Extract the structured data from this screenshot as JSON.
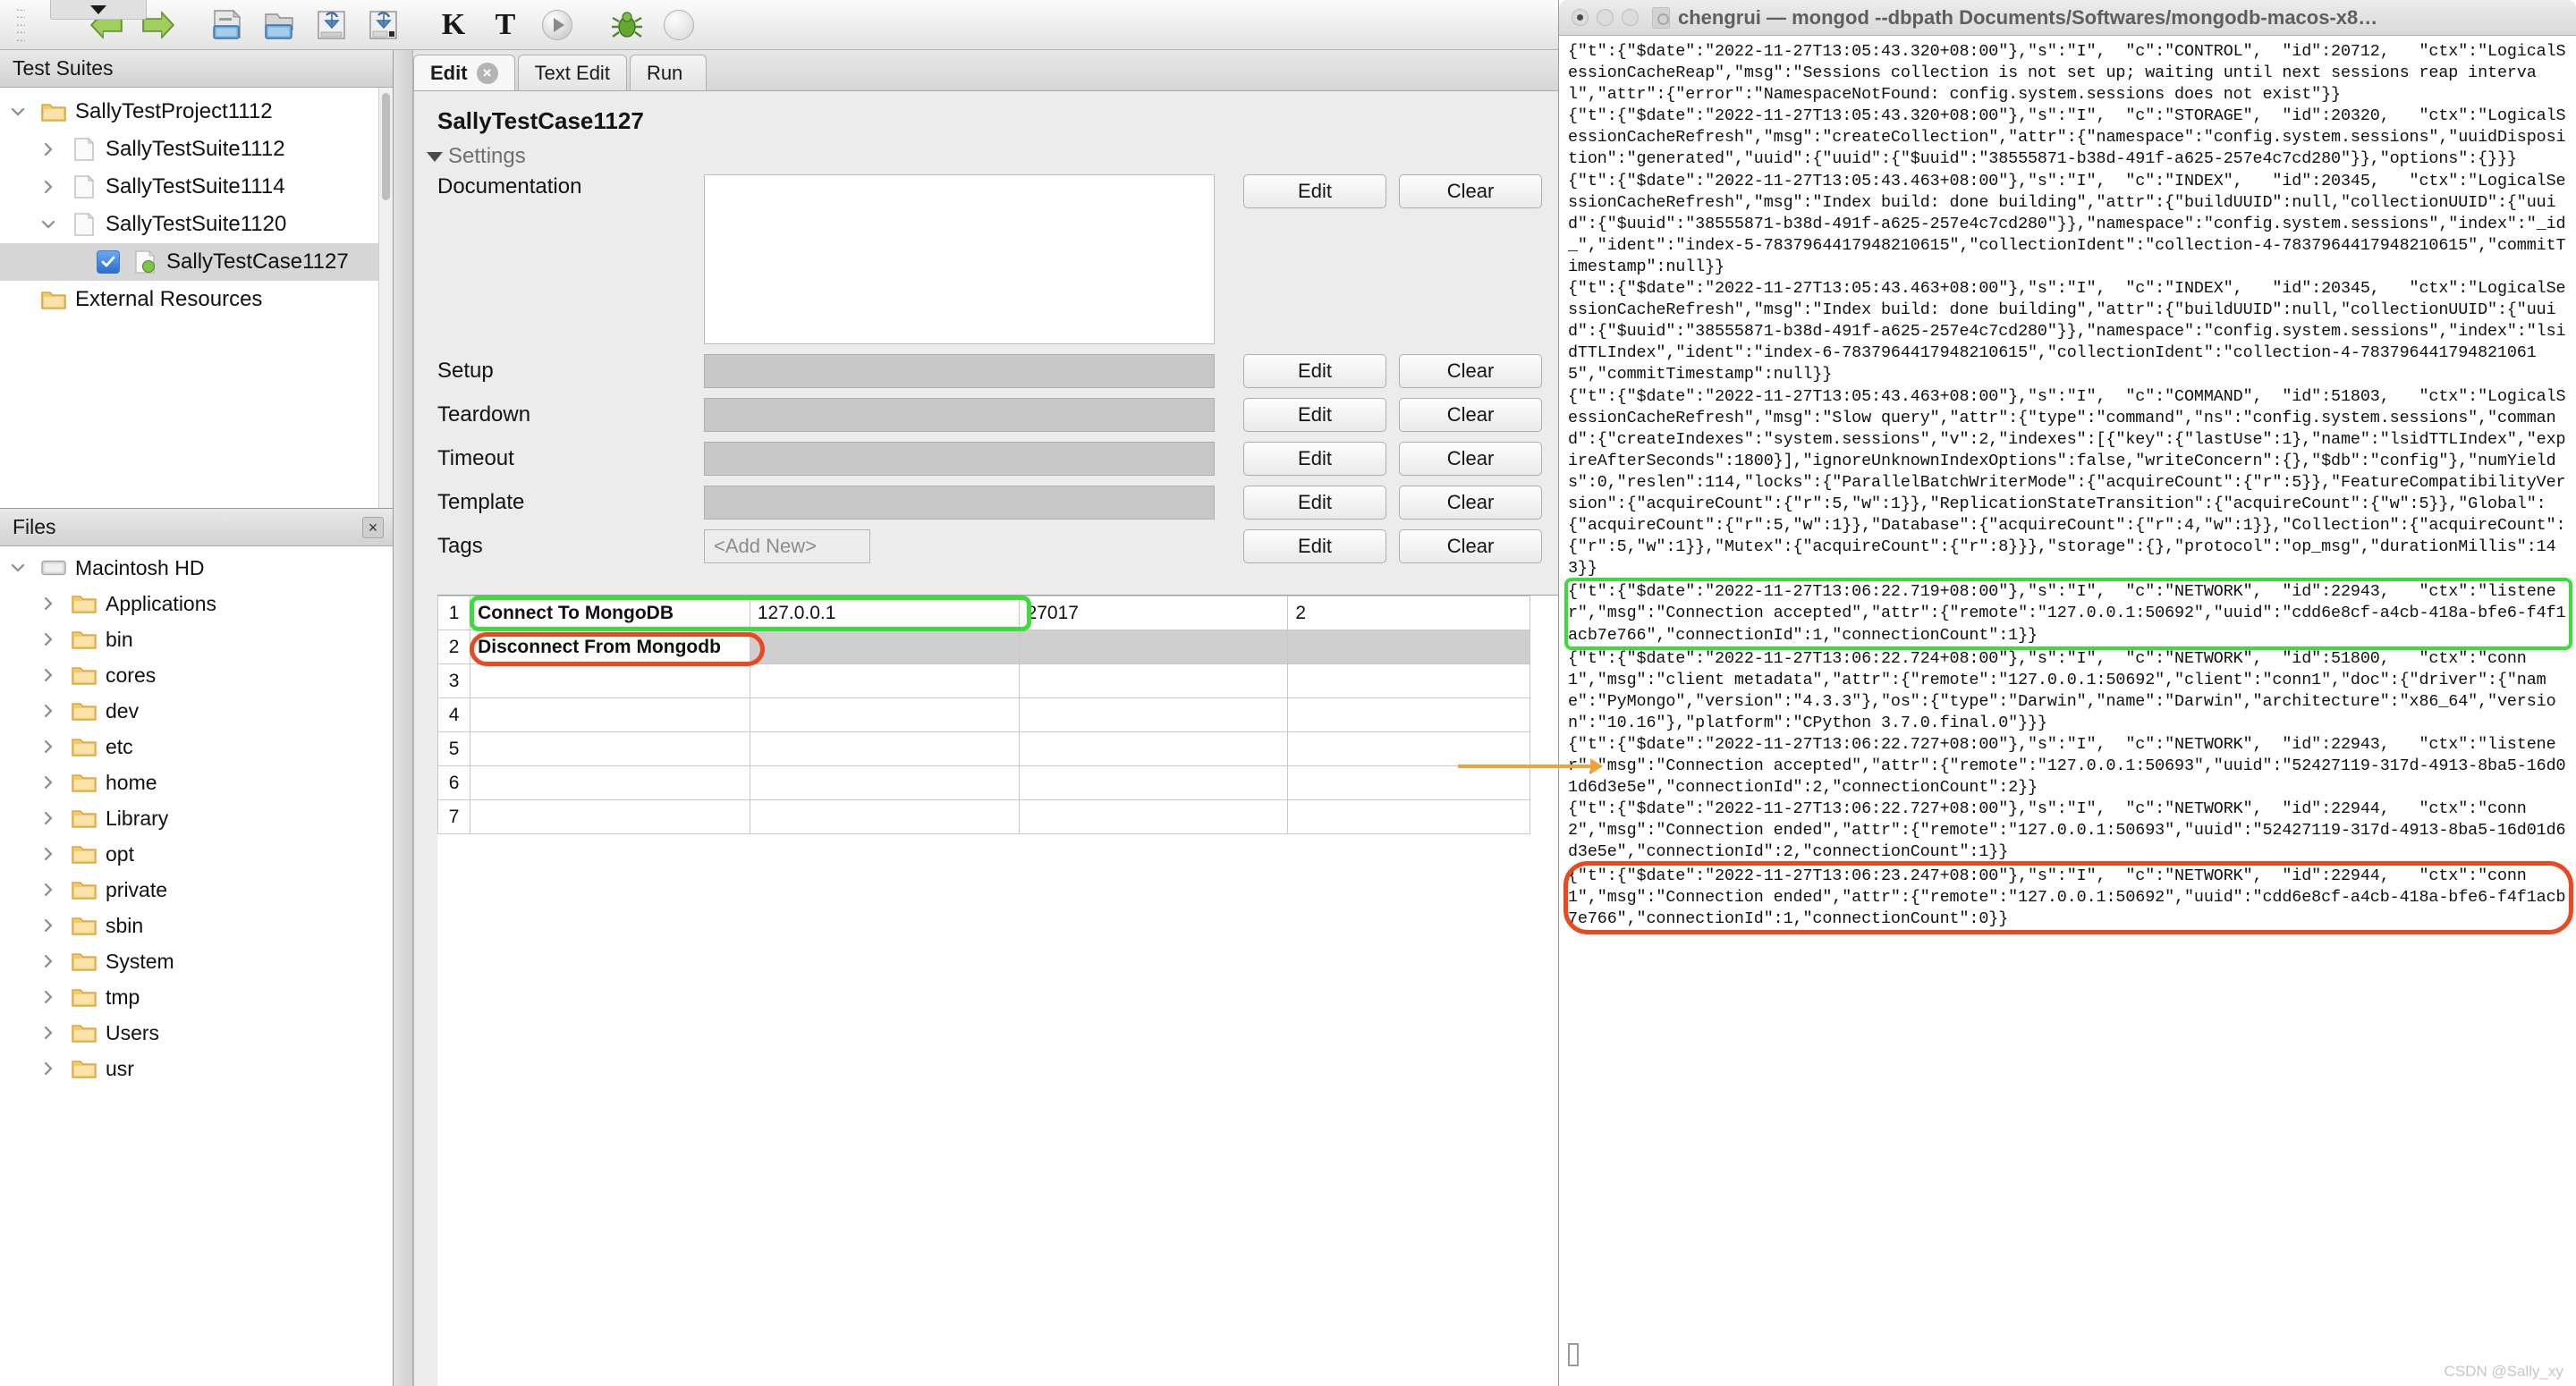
{
  "toolbar": {
    "icons": [
      {
        "name": "back-arrow-icon",
        "label": "Back"
      },
      {
        "name": "forward-arrow-icon",
        "label": "Forward"
      },
      {
        "name": "new-file-icon",
        "label": "New"
      },
      {
        "name": "open-folder-icon",
        "label": "Open"
      },
      {
        "name": "save-icon",
        "label": "Save"
      },
      {
        "name": "save-all-icon",
        "label": "Save All"
      },
      {
        "name": "keyword-k-icon",
        "label": "K"
      },
      {
        "name": "testcase-t-icon",
        "label": "T"
      },
      {
        "name": "run-circle-icon",
        "label": "Run"
      },
      {
        "name": "bug-icon",
        "label": "Debug"
      },
      {
        "name": "stop-circle-icon",
        "label": "Stop"
      }
    ]
  },
  "test_suites_pane": {
    "title": "Test Suites",
    "tree": [
      {
        "label": "SallyTestProject1112",
        "depth": 0,
        "twist": "down",
        "icon": "folder-icon",
        "selected": false,
        "checkbox": false
      },
      {
        "label": "SallyTestSuite1112",
        "depth": 1,
        "twist": "right",
        "icon": "file-icon",
        "selected": false,
        "checkbox": false
      },
      {
        "label": "SallyTestSuite1114",
        "depth": 1,
        "twist": "right",
        "icon": "file-icon",
        "selected": false,
        "checkbox": false
      },
      {
        "label": "SallyTestSuite1120",
        "depth": 1,
        "twist": "down",
        "icon": "file-icon",
        "selected": false,
        "checkbox": false
      },
      {
        "label": "SallyTestCase1127",
        "depth": 2,
        "twist": "none",
        "icon": "testcase-icon",
        "selected": true,
        "checkbox": true
      },
      {
        "label": "External Resources",
        "depth": 0,
        "twist": "none",
        "icon": "folder-icon",
        "selected": false,
        "checkbox": false
      }
    ]
  },
  "files_pane": {
    "title": "Files",
    "tree": [
      {
        "label": "Macintosh HD",
        "depth": 0,
        "twist": "down",
        "icon": "drive-icon"
      },
      {
        "label": "Applications",
        "depth": 1,
        "twist": "right",
        "icon": "folder-icon"
      },
      {
        "label": "bin",
        "depth": 1,
        "twist": "right",
        "icon": "folder-icon"
      },
      {
        "label": "cores",
        "depth": 1,
        "twist": "right",
        "icon": "folder-icon"
      },
      {
        "label": "dev",
        "depth": 1,
        "twist": "right",
        "icon": "folder-icon"
      },
      {
        "label": "etc",
        "depth": 1,
        "twist": "right",
        "icon": "folder-icon"
      },
      {
        "label": "home",
        "depth": 1,
        "twist": "right",
        "icon": "folder-icon"
      },
      {
        "label": "Library",
        "depth": 1,
        "twist": "right",
        "icon": "folder-icon"
      },
      {
        "label": "opt",
        "depth": 1,
        "twist": "right",
        "icon": "folder-icon"
      },
      {
        "label": "private",
        "depth": 1,
        "twist": "right",
        "icon": "folder-icon"
      },
      {
        "label": "sbin",
        "depth": 1,
        "twist": "right",
        "icon": "folder-icon"
      },
      {
        "label": "System",
        "depth": 1,
        "twist": "right",
        "icon": "folder-icon"
      },
      {
        "label": "tmp",
        "depth": 1,
        "twist": "right",
        "icon": "folder-icon"
      },
      {
        "label": "Users",
        "depth": 1,
        "twist": "right",
        "icon": "folder-icon"
      },
      {
        "label": "usr",
        "depth": 1,
        "twist": "right",
        "icon": "folder-icon"
      }
    ]
  },
  "editor": {
    "tabs": [
      {
        "label": "Edit",
        "active": true,
        "closable": true
      },
      {
        "label": "Text Edit",
        "active": false,
        "closable": false
      },
      {
        "label": "Run",
        "active": false,
        "closable": false
      }
    ],
    "case_title": "SallyTestCase1127",
    "settings_label": "Settings",
    "rows": [
      {
        "label": "Documentation",
        "value": "",
        "kind": "doc",
        "edit": "Edit",
        "clear": "Clear"
      },
      {
        "label": "Setup",
        "value": "",
        "kind": "field",
        "edit": "Edit",
        "clear": "Clear"
      },
      {
        "label": "Teardown",
        "value": "",
        "kind": "field",
        "edit": "Edit",
        "clear": "Clear"
      },
      {
        "label": "Timeout",
        "value": "",
        "kind": "field",
        "edit": "Edit",
        "clear": "Clear"
      },
      {
        "label": "Template",
        "value": "",
        "kind": "field",
        "edit": "Edit",
        "clear": "Clear"
      },
      {
        "label": "Tags",
        "value": "<Add New>",
        "kind": "tags",
        "edit": "Edit",
        "clear": "Clear"
      }
    ],
    "grid": {
      "rows": [
        {
          "num": "1",
          "cells": [
            "Connect To MongoDB",
            "127.0.0.1",
            "27017",
            "2"
          ],
          "highlight": "green"
        },
        {
          "num": "2",
          "cells": [
            "Disconnect From Mongodb",
            "",
            "",
            ""
          ],
          "highlight": "red"
        },
        {
          "num": "3",
          "cells": [
            "",
            "",
            "",
            ""
          ],
          "highlight": ""
        },
        {
          "num": "4",
          "cells": [
            "",
            "",
            "",
            ""
          ],
          "highlight": ""
        },
        {
          "num": "5",
          "cells": [
            "",
            "",
            "",
            ""
          ],
          "highlight": ""
        },
        {
          "num": "6",
          "cells": [
            "",
            "",
            "",
            ""
          ],
          "highlight": ""
        },
        {
          "num": "7",
          "cells": [
            "",
            "",
            "",
            ""
          ],
          "highlight": ""
        }
      ]
    }
  },
  "terminal": {
    "title": "chengrui — mongod --dbpath Documents/Softwares/mongodb-macos-x8…",
    "watermark": "CSDN @Sally_xy",
    "log_blocks": [
      {
        "highlight": "",
        "text": "{\"t\":{\"$date\":\"2022-11-27T13:05:43.320+08:00\"},\"s\":\"I\",  \"c\":\"CONTROL\",  \"id\":20712,   \"ctx\":\"LogicalSessionCacheReap\",\"msg\":\"Sessions collection is not set up; waiting until next sessions reap interval\",\"attr\":{\"error\":\"NamespaceNotFound: config.system.sessions does not exist\"}}"
      },
      {
        "highlight": "",
        "text": "{\"t\":{\"$date\":\"2022-11-27T13:05:43.320+08:00\"},\"s\":\"I\",  \"c\":\"STORAGE\",  \"id\":20320,   \"ctx\":\"LogicalSessionCacheRefresh\",\"msg\":\"createCollection\",\"attr\":{\"namespace\":\"config.system.sessions\",\"uuidDisposition\":\"generated\",\"uuid\":{\"uuid\":{\"$uuid\":\"38555871-b38d-491f-a625-257e4c7cd280\"}},\"options\":{}}}"
      },
      {
        "highlight": "",
        "text": "{\"t\":{\"$date\":\"2022-11-27T13:05:43.463+08:00\"},\"s\":\"I\",  \"c\":\"INDEX\",   \"id\":20345,   \"ctx\":\"LogicalSessionCacheRefresh\",\"msg\":\"Index build: done building\",\"attr\":{\"buildUUID\":null,\"collectionUUID\":{\"uuid\":{\"$uuid\":\"38555871-b38d-491f-a625-257e4c7cd280\"}},\"namespace\":\"config.system.sessions\",\"index\":\"_id_\",\"ident\":\"index-5-7837964417948210615\",\"collectionIdent\":\"collection-4-7837964417948210615\",\"commitTimestamp\":null}}"
      },
      {
        "highlight": "",
        "text": "{\"t\":{\"$date\":\"2022-11-27T13:05:43.463+08:00\"},\"s\":\"I\",  \"c\":\"INDEX\",   \"id\":20345,   \"ctx\":\"LogicalSessionCacheRefresh\",\"msg\":\"Index build: done building\",\"attr\":{\"buildUUID\":null,\"collectionUUID\":{\"uuid\":{\"$uuid\":\"38555871-b38d-491f-a625-257e4c7cd280\"}},\"namespace\":\"config.system.sessions\",\"index\":\"lsidTTLIndex\",\"ident\":\"index-6-7837964417948210615\",\"collectionIdent\":\"collection-4-7837964417948210615\",\"commitTimestamp\":null}}"
      },
      {
        "highlight": "",
        "text": "{\"t\":{\"$date\":\"2022-11-27T13:05:43.463+08:00\"},\"s\":\"I\",  \"c\":\"COMMAND\",  \"id\":51803,   \"ctx\":\"LogicalSessionCacheRefresh\",\"msg\":\"Slow query\",\"attr\":{\"type\":\"command\",\"ns\":\"config.system.sessions\",\"command\":{\"createIndexes\":\"system.sessions\",\"v\":2,\"indexes\":[{\"key\":{\"lastUse\":1},\"name\":\"lsidTTLIndex\",\"expireAfterSeconds\":1800}],\"ignoreUnknownIndexOptions\":false,\"writeConcern\":{},\"$db\":\"config\"},\"numYields\":0,\"reslen\":114,\"locks\":{\"ParallelBatchWriterMode\":{\"acquireCount\":{\"r\":5}},\"FeatureCompatibilityVersion\":{\"acquireCount\":{\"r\":5,\"w\":1}},\"ReplicationStateTransition\":{\"acquireCount\":{\"w\":5}},\"Global\":{\"acquireCount\":{\"r\":5,\"w\":1}},\"Database\":{\"acquireCount\":{\"r\":4,\"w\":1}},\"Collection\":{\"acquireCount\":{\"r\":5,\"w\":1}},\"Mutex\":{\"acquireCount\":{\"r\":8}}},\"storage\":{},\"protocol\":\"op_msg\",\"durationMillis\":143}}"
      },
      {
        "highlight": "green",
        "text": "{\"t\":{\"$date\":\"2022-11-27T13:06:22.719+08:00\"},\"s\":\"I\",  \"c\":\"NETWORK\",  \"id\":22943,   \"ctx\":\"listener\",\"msg\":\"Connection accepted\",\"attr\":{\"remote\":\"127.0.0.1:50692\",\"uuid\":\"cdd6e8cf-a4cb-418a-bfe6-f4f1acb7e766\",\"connectionId\":1,\"connectionCount\":1}}"
      },
      {
        "highlight": "",
        "text": "{\"t\":{\"$date\":\"2022-11-27T13:06:22.724+08:00\"},\"s\":\"I\",  \"c\":\"NETWORK\",  \"id\":51800,   \"ctx\":\"conn1\",\"msg\":\"client metadata\",\"attr\":{\"remote\":\"127.0.0.1:50692\",\"client\":\"conn1\",\"doc\":{\"driver\":{\"name\":\"PyMongo\",\"version\":\"4.3.3\"},\"os\":{\"type\":\"Darwin\",\"name\":\"Darwin\",\"architecture\":\"x86_64\",\"version\":\"10.16\"},\"platform\":\"CPython 3.7.0.final.0\"}}}"
      },
      {
        "highlight": "",
        "text": "{\"t\":{\"$date\":\"2022-11-27T13:06:22.727+08:00\"},\"s\":\"I\",  \"c\":\"NETWORK\",  \"id\":22943,   \"ctx\":\"listener\",\"msg\":\"Connection accepted\",\"attr\":{\"remote\":\"127.0.0.1:50693\",\"uuid\":\"52427119-317d-4913-8ba5-16d01d6d3e5e\",\"connectionId\":2,\"connectionCount\":2}}"
      },
      {
        "highlight": "",
        "text": "{\"t\":{\"$date\":\"2022-11-27T13:06:22.727+08:00\"},\"s\":\"I\",  \"c\":\"NETWORK\",  \"id\":22944,   \"ctx\":\"conn2\",\"msg\":\"Connection ended\",\"attr\":{\"remote\":\"127.0.0.1:50693\",\"uuid\":\"52427119-317d-4913-8ba5-16d01d6d3e5e\",\"connectionId\":2,\"connectionCount\":1}}"
      },
      {
        "highlight": "red",
        "text": "{\"t\":{\"$date\":\"2022-11-27T13:06:23.247+08:00\"},\"s\":\"I\",  \"c\":\"NETWORK\",  \"id\":22944,   \"ctx\":\"conn1\",\"msg\":\"Connection ended\",\"attr\":{\"remote\":\"127.0.0.1:50692\",\"uuid\":\"cdd6e8cf-a4cb-418a-bfe6-f4f1acb7e766\",\"connectionId\":1,\"connectionCount\":0}}"
      }
    ]
  },
  "colors": {
    "keyword_blue": "#1f7fc4",
    "highlight_green": "#3bdd3b",
    "highlight_red": "#e8491f",
    "arrow_orange": "#f0a23c"
  }
}
